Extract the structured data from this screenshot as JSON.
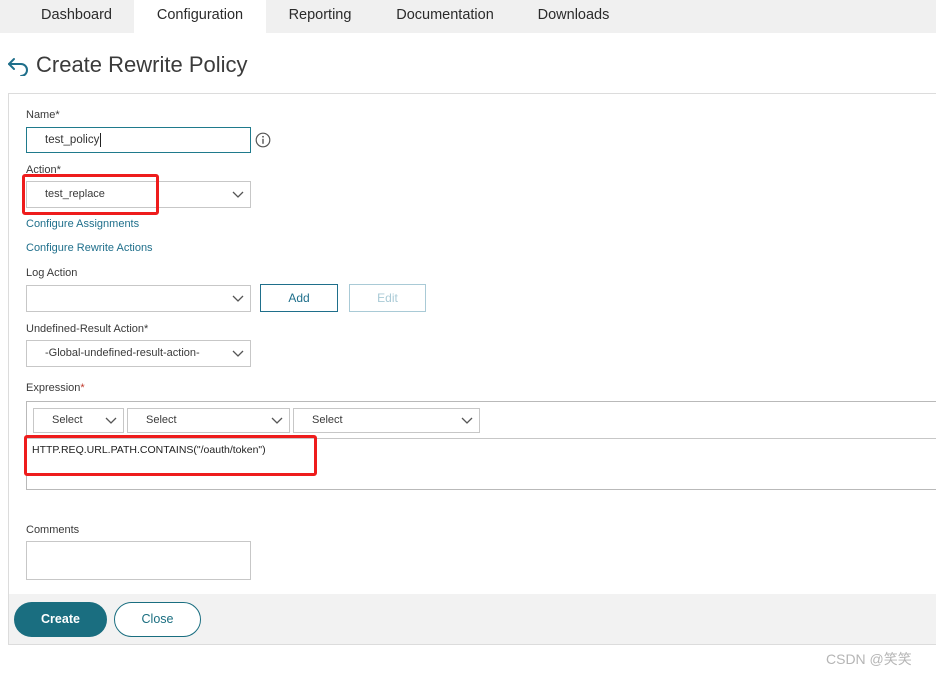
{
  "topnav": {
    "tabs": [
      {
        "label": "Dashboard"
      },
      {
        "label": "Configuration"
      },
      {
        "label": "Reporting"
      },
      {
        "label": "Documentation"
      },
      {
        "label": "Downloads"
      }
    ],
    "active": "Configuration"
  },
  "header": {
    "title": "Create Rewrite Policy",
    "back_icon": "back-arrow-icon"
  },
  "form": {
    "name": {
      "label": "Name",
      "required_mark": "*",
      "value": "test_policy"
    },
    "action": {
      "label": "Action",
      "required_mark": "*",
      "value": "test_replace"
    },
    "configure_assignments_link": "Configure Assignments",
    "configure_rewrite_actions_link": "Configure Rewrite Actions",
    "log_action": {
      "label": "Log Action",
      "value": "",
      "add_label": "Add",
      "edit_label": "Edit"
    },
    "undefined_result_action": {
      "label": "Undefined-Result Action",
      "required_mark": "*",
      "value": "-Global-undefined-result-action-"
    },
    "expression": {
      "label": "Expression",
      "required_mark": "*",
      "selects": [
        {
          "value": "Select"
        },
        {
          "value": "Select"
        },
        {
          "value": "Select"
        }
      ],
      "value": "HTTP.REQ.URL.PATH.CONTAINS(\"/oauth/token\")"
    },
    "comments": {
      "label": "Comments",
      "value": ""
    }
  },
  "footer": {
    "create_label": "Create",
    "close_label": "Close"
  },
  "watermark": "CSDN @笑笑",
  "colors": {
    "accent": "#1a6e80",
    "link": "#1f6f8b",
    "highlight": "#ee1c1c",
    "required": "#c0392b"
  }
}
